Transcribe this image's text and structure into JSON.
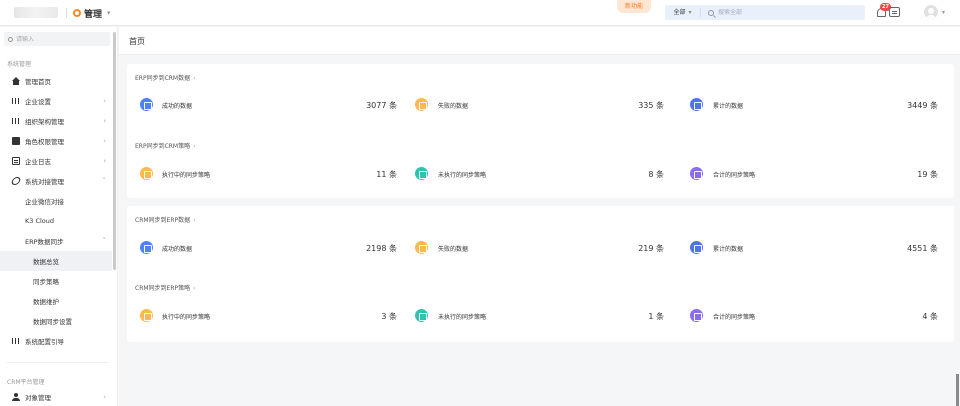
{
  "header": {
    "module": "管理",
    "new_feature": "新功能",
    "search_scope": "全部",
    "search_placeholder": "搜索全部",
    "notification_count": "27"
  },
  "sidebar": {
    "search_placeholder": "请输入",
    "section1": "系统管理",
    "items": [
      {
        "label": "管理首页"
      },
      {
        "label": "企业设置"
      },
      {
        "label": "组织架构管理"
      },
      {
        "label": "角色权限管理"
      },
      {
        "label": "企业日志"
      },
      {
        "label": "系统对接管理"
      },
      {
        "label": "企业微信对接"
      },
      {
        "label": "K3 Cloud"
      },
      {
        "label": "ERP数据同步"
      },
      {
        "label": "数据总览"
      },
      {
        "label": "同步策略"
      },
      {
        "label": "数据维护"
      },
      {
        "label": "数据同步设置"
      },
      {
        "label": "系统配置引导"
      }
    ],
    "section2": "CRM平台管理",
    "item_object": "对象管理"
  },
  "main": {
    "page_title": "首页",
    "groups": [
      {
        "title": "ERP同步到CRM数据",
        "stats": [
          {
            "label": "成功的数据",
            "value": "3077 条",
            "color": "#4f82f7"
          },
          {
            "label": "失败的数据",
            "value": "335 条",
            "color": "#ffb84d"
          },
          {
            "label": "累计的数据",
            "value": "3449 条",
            "color": "#4d74ea"
          }
        ]
      },
      {
        "title": "ERP同步到CRM策略",
        "stats": [
          {
            "label": "执行中的同步策略",
            "value": "11 条",
            "color": "#ffb84d"
          },
          {
            "label": "未执行的同步策略",
            "value": "8 条",
            "color": "#2bc5b4"
          },
          {
            "label": "合计的同步策略",
            "value": "19 条",
            "color": "#8a6cf0"
          }
        ]
      },
      {
        "title": "CRM同步到ERP数据",
        "stats": [
          {
            "label": "成功的数据",
            "value": "2198 条",
            "color": "#4f82f7"
          },
          {
            "label": "失败的数据",
            "value": "219 条",
            "color": "#ffb84d"
          },
          {
            "label": "累计的数据",
            "value": "4551 条",
            "color": "#4d74ea"
          }
        ]
      },
      {
        "title": "CRM同步到ERP策略",
        "stats": [
          {
            "label": "执行中的同步策略",
            "value": "3 条",
            "color": "#ffb84d"
          },
          {
            "label": "未执行的同步策略",
            "value": "1 条",
            "color": "#2bc5b4"
          },
          {
            "label": "合计的同步策略",
            "value": "4 条",
            "color": "#8a6cf0"
          }
        ]
      }
    ]
  }
}
